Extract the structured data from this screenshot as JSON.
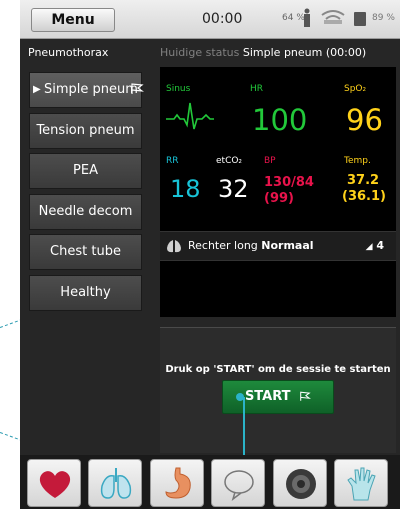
{
  "statusbar": {
    "menu_label": "Menu",
    "clock": "00:00",
    "battery_left": "64 %",
    "battery_right": "89 %"
  },
  "header": {
    "scenario_title": "Pneumothorax",
    "current_status_label": "Huidige status",
    "current_status_value": "Simple pneum (00:00)"
  },
  "scenarios": [
    {
      "label": "Simple pneum",
      "active": true
    },
    {
      "label": "Tension pneum",
      "active": false
    },
    {
      "label": "PEA",
      "active": false
    },
    {
      "label": "Needle decom",
      "active": false
    },
    {
      "label": "Chest tube",
      "active": false
    },
    {
      "label": "Healthy",
      "active": false
    }
  ],
  "monitor": {
    "rhythm_label": "Sinus",
    "hr_label": "HR",
    "hr_value": "100",
    "spo2_label": "SpO₂",
    "spo2_value": "96",
    "rr_label": "RR",
    "rr_value": "18",
    "etco2_label": "etCO₂",
    "etco2_value": "32",
    "bp_label": "BP",
    "bp_value": "130/84",
    "bp_mean": "(99)",
    "temp_label": "Temp.",
    "temp_value": "37.2",
    "temp_sub": "(36.1)",
    "colors": {
      "green": "#22c93a",
      "cyan": "#18c4d8",
      "white": "#ffffff",
      "red": "#e8134b",
      "yellow": "#ffd21a"
    }
  },
  "lung_status": {
    "side_label": "Rechter long",
    "state": "Normaal",
    "level": "4"
  },
  "start_panel": {
    "message": "Druk op 'START' om de sessie te starten",
    "button_label": "START"
  },
  "bottom_icons": [
    "heart-icon",
    "lungs-icon",
    "stomach-icon",
    "speech-bubble-icon",
    "speaker-icon",
    "glove-icon"
  ]
}
